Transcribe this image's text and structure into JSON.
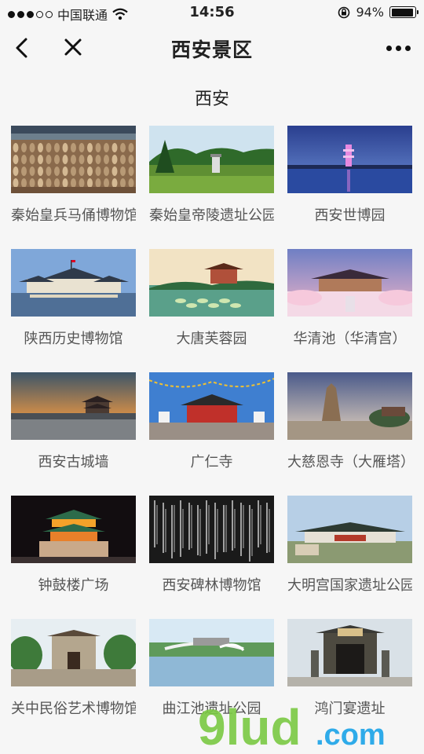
{
  "status": {
    "carrier": "中国联通",
    "time": "14:56",
    "battery_text": "94%",
    "battery_level": 0.94,
    "signal_bars_filled": 3,
    "signal_bars_total": 5
  },
  "nav": {
    "title": "西安景区"
  },
  "section": {
    "title": "西安"
  },
  "spots": [
    {
      "label": "秦始皇兵马俑博物馆",
      "image": "terracotta-army-photo"
    },
    {
      "label": "秦始皇帝陵遗址公园",
      "image": "mausoleum-park-photo"
    },
    {
      "label": "西安世博园",
      "image": "expo-garden-photo"
    },
    {
      "label": "陕西历史博物馆",
      "image": "history-museum-photo"
    },
    {
      "label": "大唐芙蓉园",
      "image": "furong-garden-photo"
    },
    {
      "label": "华清池（华清宫）",
      "image": "huaqing-palace-photo"
    },
    {
      "label": "西安古城墙",
      "image": "city-wall-photo"
    },
    {
      "label": "广仁寺",
      "image": "guangren-temple-photo"
    },
    {
      "label": "大慈恩寺（大雁塔）",
      "image": "wild-goose-pagoda-photo"
    },
    {
      "label": "钟鼓楼广场",
      "image": "bell-tower-photo"
    },
    {
      "label": "西安碑林博物馆",
      "image": "stele-forest-photo"
    },
    {
      "label": "大明宫国家遗址公园",
      "image": "daming-palace-photo"
    },
    {
      "label": "关中民俗艺术博物馆",
      "image": "folk-art-museum-photo"
    },
    {
      "label": "曲江池遗址公园",
      "image": "qujiang-pool-photo"
    },
    {
      "label": "鸿门宴遗址",
      "image": "hongmen-feast-photo"
    }
  ],
  "watermark": {
    "text": "9lud.com"
  },
  "colors": {
    "background": "#f6f6f6",
    "watermark_green": "#7ac943",
    "watermark_blue": "#1aa3e8"
  }
}
